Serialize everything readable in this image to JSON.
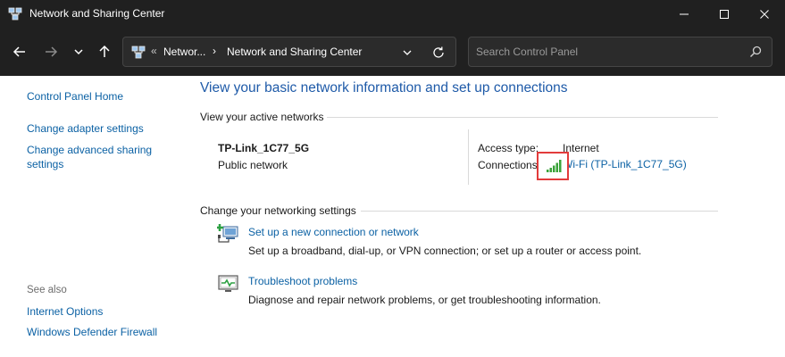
{
  "window": {
    "title": "Network and Sharing Center",
    "controls": {
      "minimize": "minimize",
      "maximize": "maximize",
      "close": "close"
    }
  },
  "navbar": {
    "breadcrumb_overflow": "«",
    "breadcrumb": [
      "Networ...",
      "Network and Sharing Center"
    ],
    "breadcrumb_separator": "›",
    "search_placeholder": "Search Control Panel"
  },
  "sidebar": {
    "items": [
      "Control Panel Home",
      "Change adapter settings",
      "Change advanced sharing settings"
    ],
    "see_also_label": "See also",
    "see_also": [
      "Internet Options",
      "Windows Defender Firewall"
    ]
  },
  "main": {
    "title": "View your basic network information and set up connections",
    "active_networks_header": "View your active networks",
    "network": {
      "name": "TP-Link_1C77_5G",
      "type": "Public network",
      "access_type_label": "Access type:",
      "access_type_value": "Internet",
      "connections_label": "Connections:",
      "connections_value": "Wi-Fi (TP-Link_1C77_5G)"
    },
    "settings_header": "Change your networking settings",
    "tasks": [
      {
        "link": "Set up a new connection or network",
        "description": "Set up a broadband, dial-up, or VPN connection; or set up a router or access point."
      },
      {
        "link": "Troubleshoot problems",
        "description": "Diagnose and repair network problems, or get troubleshooting information."
      }
    ]
  },
  "colors": {
    "title_bar": "#202020",
    "link": "#0b61a4",
    "heading": "#1e5aa8",
    "highlight_box": "#e23b3b",
    "signal": "#3aa33a"
  },
  "icons": [
    "network-center-icon",
    "back-arrow-icon",
    "forward-arrow-icon",
    "recent-locations-icon",
    "up-arrow-icon",
    "refresh-icon",
    "search-icon",
    "wifi-signal-icon",
    "new-connection-icon",
    "troubleshoot-icon"
  ]
}
